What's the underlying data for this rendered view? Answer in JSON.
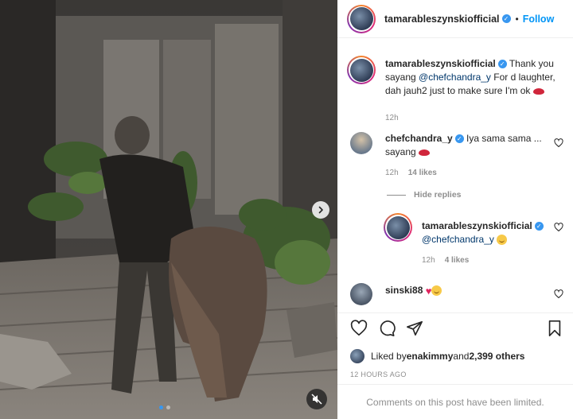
{
  "post": {
    "username": "tamarableszynskiofficial",
    "separator": "•",
    "follow_label": "Follow"
  },
  "caption": {
    "username": "tamarableszynskiofficial",
    "text_before": " Thank you sayang ",
    "mention": "@chefchandra_y",
    "text_after": " For d laughter, dah jauh2 just to make sure I'm ok",
    "time": "12h"
  },
  "comments": [
    {
      "username": "chefchandra_y",
      "text": " Iya sama sama ... sayang",
      "time": "12h",
      "likes": "14 likes"
    }
  ],
  "hide_replies_label": "Hide replies",
  "reply": {
    "username": "tamarableszynskiofficial",
    "mention": "@chefchandra_y",
    "time": "12h",
    "likes": "4 likes"
  },
  "comment2": {
    "username": "sinski88"
  },
  "likes": {
    "prefix": "Liked by ",
    "user": "enakimmy",
    "middle": " and ",
    "others": "2,399 others"
  },
  "time_ago": "12 HOURS AGO",
  "comments_limited": "Comments on this post have been limited.",
  "icons": {
    "next": "chevron-right-icon",
    "mute": "muted-speaker-icon",
    "like": "heart-icon",
    "comment": "comment-bubble-icon",
    "share": "paper-plane-icon",
    "save": "bookmark-icon",
    "verified": "verified-badge-icon"
  },
  "carousel": {
    "count": 2,
    "active": 1
  },
  "colors": {
    "accent": "#0095f6",
    "verified": "#3897f0",
    "muted_text": "#8e8e8e"
  }
}
